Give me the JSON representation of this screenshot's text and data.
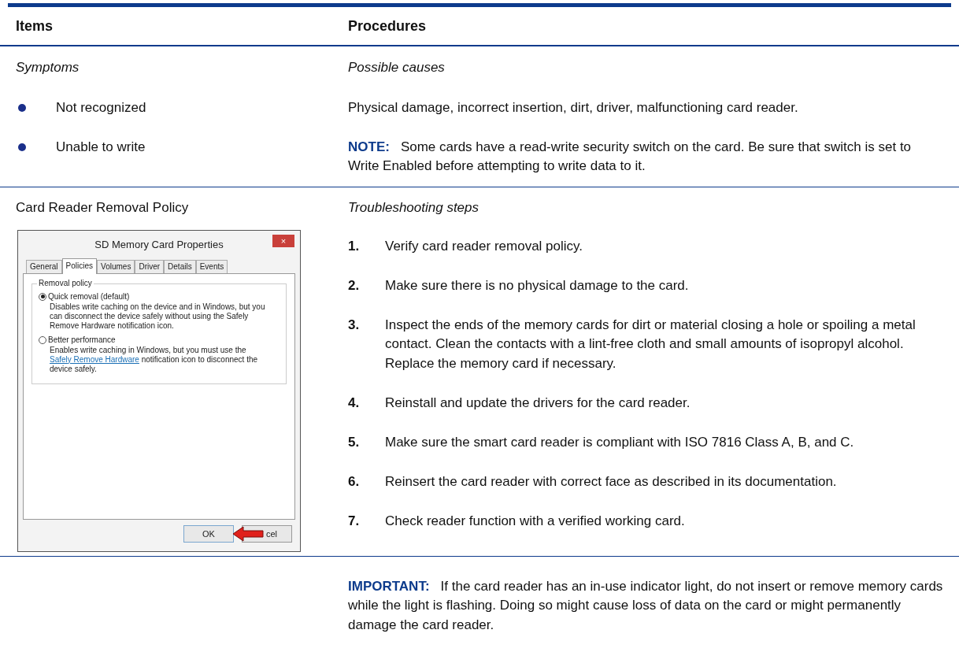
{
  "table": {
    "columns": [
      "Items",
      "Procedures"
    ],
    "symptoms": {
      "item_heading": "Symptoms",
      "procedure_heading": "Possible causes",
      "rows": [
        {
          "symptom": "Not recognized",
          "kind": "text",
          "text": "Physical damage, incorrect insertion, dirt, driver, malfunctioning card reader."
        },
        {
          "symptom": "Unable to write",
          "kind": "note",
          "label": "NOTE:",
          "text": "Some cards have a read-write security switch on the card. Be sure that switch is set to Write Enabled before attempting to write data to it."
        }
      ]
    },
    "removal": {
      "item": "Card Reader Removal Policy",
      "procedure_heading": "Troubleshooting steps",
      "dialog": {
        "title": "SD Memory Card Properties",
        "close": "×",
        "tabs": [
          {
            "label": "General",
            "selected": false
          },
          {
            "label": "Policies",
            "selected": true
          },
          {
            "label": "Volumes",
            "selected": false
          },
          {
            "label": "Driver",
            "selected": false
          },
          {
            "label": "Details",
            "selected": false
          },
          {
            "label": "Events",
            "selected": false
          }
        ],
        "group_label": "Removal policy",
        "options": [
          {
            "label": "Quick removal (default)",
            "selected": true,
            "description": "Disables write caching on the device and in Windows, but you can disconnect the device safely without using the Safely Remove Hardware notification icon."
          },
          {
            "label": "Better performance",
            "selected": false,
            "description": "Enables write caching in Windows, but you must use the",
            "link": "Safely Remove Hardware",
            "description_after": "notification icon to disconnect the device safely."
          }
        ],
        "ok": "OK",
        "cancel_visible": "cel"
      },
      "steps": [
        {
          "number": "1.",
          "text": "Verify card reader removal policy."
        },
        {
          "number": "2.",
          "text": "Make sure there is no physical damage to the card."
        },
        {
          "number": "3.",
          "text": "Inspect the ends of the memory cards for dirt or material closing a hole or spoiling a metal contact. Clean the contacts with a lint-free cloth and small amounts of isopropyl alcohol. Replace the memory card if necessary."
        },
        {
          "number": "4.",
          "text": "Reinstall and update the drivers for the card reader."
        },
        {
          "number": "5.",
          "text": "Make sure the smart card reader is compliant with ISO 7816 Class A, B, and C."
        },
        {
          "number": "6.",
          "text": "Reinsert the card reader with correct face as described in its documentation."
        },
        {
          "number": "7.",
          "text": "Check reader function with a verified working card."
        }
      ]
    },
    "important": {
      "label": "IMPORTANT:",
      "text": "If the card reader has an in-use indicator light, do not insert or remove memory cards while the light is flashing. Doing so might cause loss of data on the card or might permanently damage the card reader."
    }
  }
}
